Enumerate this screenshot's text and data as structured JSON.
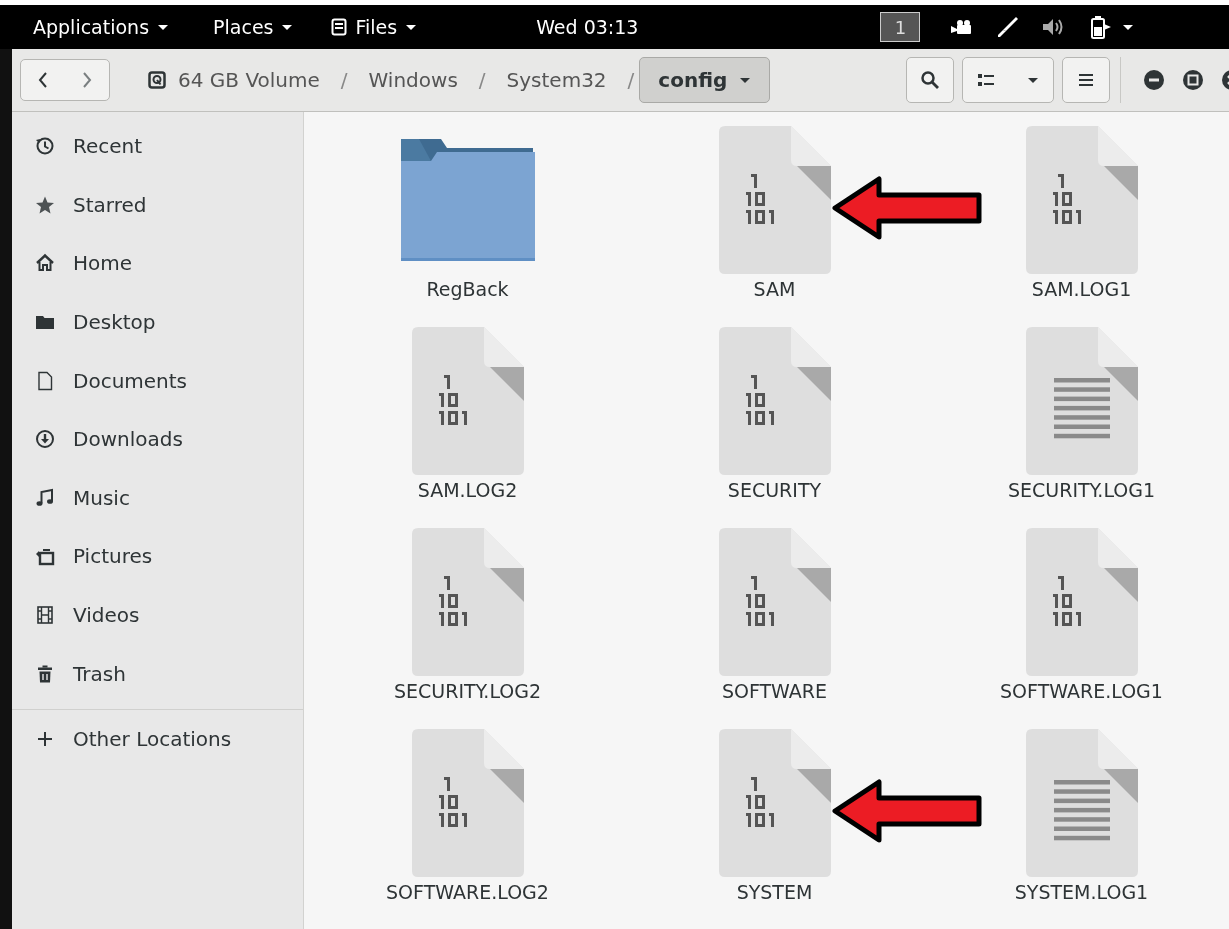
{
  "top_bar": {
    "menus": [
      {
        "label": "Applications"
      },
      {
        "label": "Places"
      },
      {
        "label": "Files"
      }
    ],
    "clock": "Wed 03:13",
    "workspace": "1"
  },
  "header": {
    "path": [
      {
        "kind": "drive",
        "label": "64 GB Volume"
      },
      {
        "kind": "separator",
        "label": "/"
      },
      {
        "kind": "folder",
        "label": "Windows"
      },
      {
        "kind": "separator",
        "label": "/"
      },
      {
        "kind": "folder",
        "label": "System32"
      },
      {
        "kind": "separator",
        "label": "/"
      },
      {
        "kind": "current",
        "label": "config"
      }
    ]
  },
  "sidebar": {
    "items": [
      {
        "label": "Recent"
      },
      {
        "label": "Starred"
      },
      {
        "label": "Home"
      },
      {
        "label": "Desktop"
      },
      {
        "label": "Documents"
      },
      {
        "label": "Downloads"
      },
      {
        "label": "Music"
      },
      {
        "label": "Pictures"
      },
      {
        "label": "Videos"
      },
      {
        "label": "Trash"
      }
    ],
    "other": {
      "label": "Other Locations"
    }
  },
  "files": [
    {
      "name": "RegBack",
      "kind": "folder",
      "arrow": false
    },
    {
      "name": "SAM",
      "kind": "binary",
      "arrow": true
    },
    {
      "name": "SAM.LOG1",
      "kind": "binary",
      "arrow": false
    },
    {
      "name": "SAM.LOG2",
      "kind": "binary",
      "arrow": false
    },
    {
      "name": "SECURITY",
      "kind": "binary",
      "arrow": false
    },
    {
      "name": "SECURITY.LOG1",
      "kind": "text",
      "arrow": false
    },
    {
      "name": "SECURITY.LOG2",
      "kind": "binary",
      "arrow": false
    },
    {
      "name": "SOFTWARE",
      "kind": "binary",
      "arrow": false
    },
    {
      "name": "SOFTWARE.LOG1",
      "kind": "binary",
      "arrow": false
    },
    {
      "name": "SOFTWARE.LOG2",
      "kind": "binary",
      "arrow": false
    },
    {
      "name": "SYSTEM",
      "kind": "binary",
      "arrow": true
    },
    {
      "name": "SYSTEM.LOG1",
      "kind": "text",
      "arrow": false
    }
  ]
}
